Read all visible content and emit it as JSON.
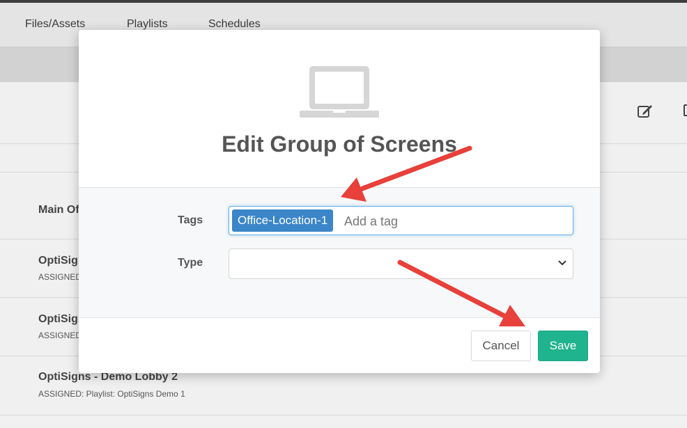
{
  "nav": {
    "tabs": [
      "Files/Assets",
      "Playlists",
      "Schedules"
    ]
  },
  "rows": [
    {
      "title": "Main Of",
      "subtitle": ""
    },
    {
      "title": "OptiSig",
      "subtitle": "ASSIGNED"
    },
    {
      "title": "OptiSig",
      "subtitle": "ASSIGNED"
    },
    {
      "title": "OptiSigns - Demo Lobby 2",
      "subtitle": "ASSIGNED: Playlist: OptiSigns Demo 1"
    }
  ],
  "background_icons": [
    "edit-icon",
    "more-icon"
  ],
  "modal": {
    "icon": "laptop-icon",
    "title": "Edit Group of Screens",
    "tags_label": "Tags",
    "tag_chip": "Office-Location-1",
    "tag_placeholder": "Add a tag",
    "type_label": "Type",
    "type_value": "",
    "cancel_label": "Cancel",
    "save_label": "Save"
  },
  "colors": {
    "accent_save": "#1fb38e",
    "tag_chip": "#3b86c8",
    "annotation_arrow": "#e8403a"
  }
}
